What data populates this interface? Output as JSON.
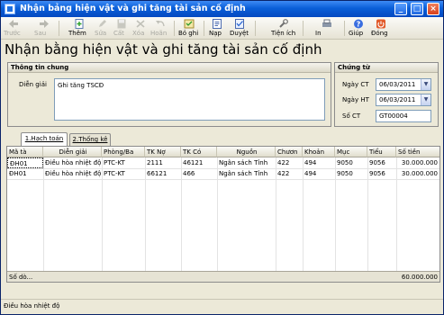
{
  "window": {
    "title": "Nhận bảng hiện vật và ghi tăng tài sản cố định"
  },
  "toolbar": [
    {
      "label": "Trước",
      "icon": "arrow-left-icon",
      "enabled": false
    },
    {
      "label": "Sau",
      "icon": "arrow-right-icon",
      "enabled": false
    },
    {
      "label": "Thêm",
      "icon": "add-document-icon",
      "enabled": true
    },
    {
      "label": "Sửa",
      "icon": "edit-icon",
      "enabled": false
    },
    {
      "label": "Cất",
      "icon": "save-icon",
      "enabled": false
    },
    {
      "label": "Xóa",
      "icon": "delete-icon",
      "enabled": false
    },
    {
      "label": "Hoãn",
      "icon": "undo-icon",
      "enabled": false
    },
    {
      "label": "Bỏ ghi",
      "icon": "unpost-icon",
      "enabled": true
    },
    {
      "label": "Nạp",
      "icon": "refresh-icon",
      "enabled": true
    },
    {
      "label": "Duyệt",
      "icon": "approve-icon",
      "enabled": true
    },
    {
      "label": "Tiện ích",
      "icon": "tools-icon",
      "enabled": true
    },
    {
      "label": "In",
      "icon": "print-icon",
      "enabled": true
    },
    {
      "label": "Giúp",
      "icon": "help-icon",
      "enabled": true
    },
    {
      "label": "Đóng",
      "icon": "close-icon",
      "enabled": true
    }
  ],
  "form_title": "Nhận bằng hiện vật và ghi tăng tài sản cố định",
  "general": {
    "header": "Thông tin chung",
    "description_label": "Diễn giải",
    "description_value": "Ghi tăng TSCĐ"
  },
  "voucher": {
    "header": "Chứng từ",
    "date_ct_label": "Ngày CT",
    "date_ct_value": "06/03/2011",
    "date_ht_label": "Ngày HT",
    "date_ht_value": "06/03/2011",
    "number_label": "Số CT",
    "number_value": "GT00004"
  },
  "tabs": [
    {
      "label": "1.Hạch toán",
      "active": true
    },
    {
      "label": "2.Thống kê",
      "active": false
    }
  ],
  "table": {
    "columns": [
      "Mã tà",
      "Diễn giải",
      "Phòng/Ba",
      "TK Nợ",
      "TK Có",
      "Nguồn",
      "Chươn",
      "Khoản",
      "Mục",
      "Tiểu",
      "Số tiền"
    ],
    "rows": [
      [
        "ĐH01",
        "Điều hòa nhiệt độ",
        "PTC-KT",
        "2111",
        "46121",
        "Ngân sách Tỉnh",
        "422",
        "494",
        "9050",
        "9056",
        "30.000.000"
      ],
      [
        "ĐH01",
        "Điều hòa nhiệt độ",
        "PTC-KT",
        "66121",
        "466",
        "Ngân sách Tỉnh",
        "422",
        "494",
        "9050",
        "9056",
        "30.000.000"
      ]
    ],
    "footer_label": "Số dò...",
    "footer_total": "60.000.000"
  },
  "status_bar": "Điều hòa nhiệt độ"
}
